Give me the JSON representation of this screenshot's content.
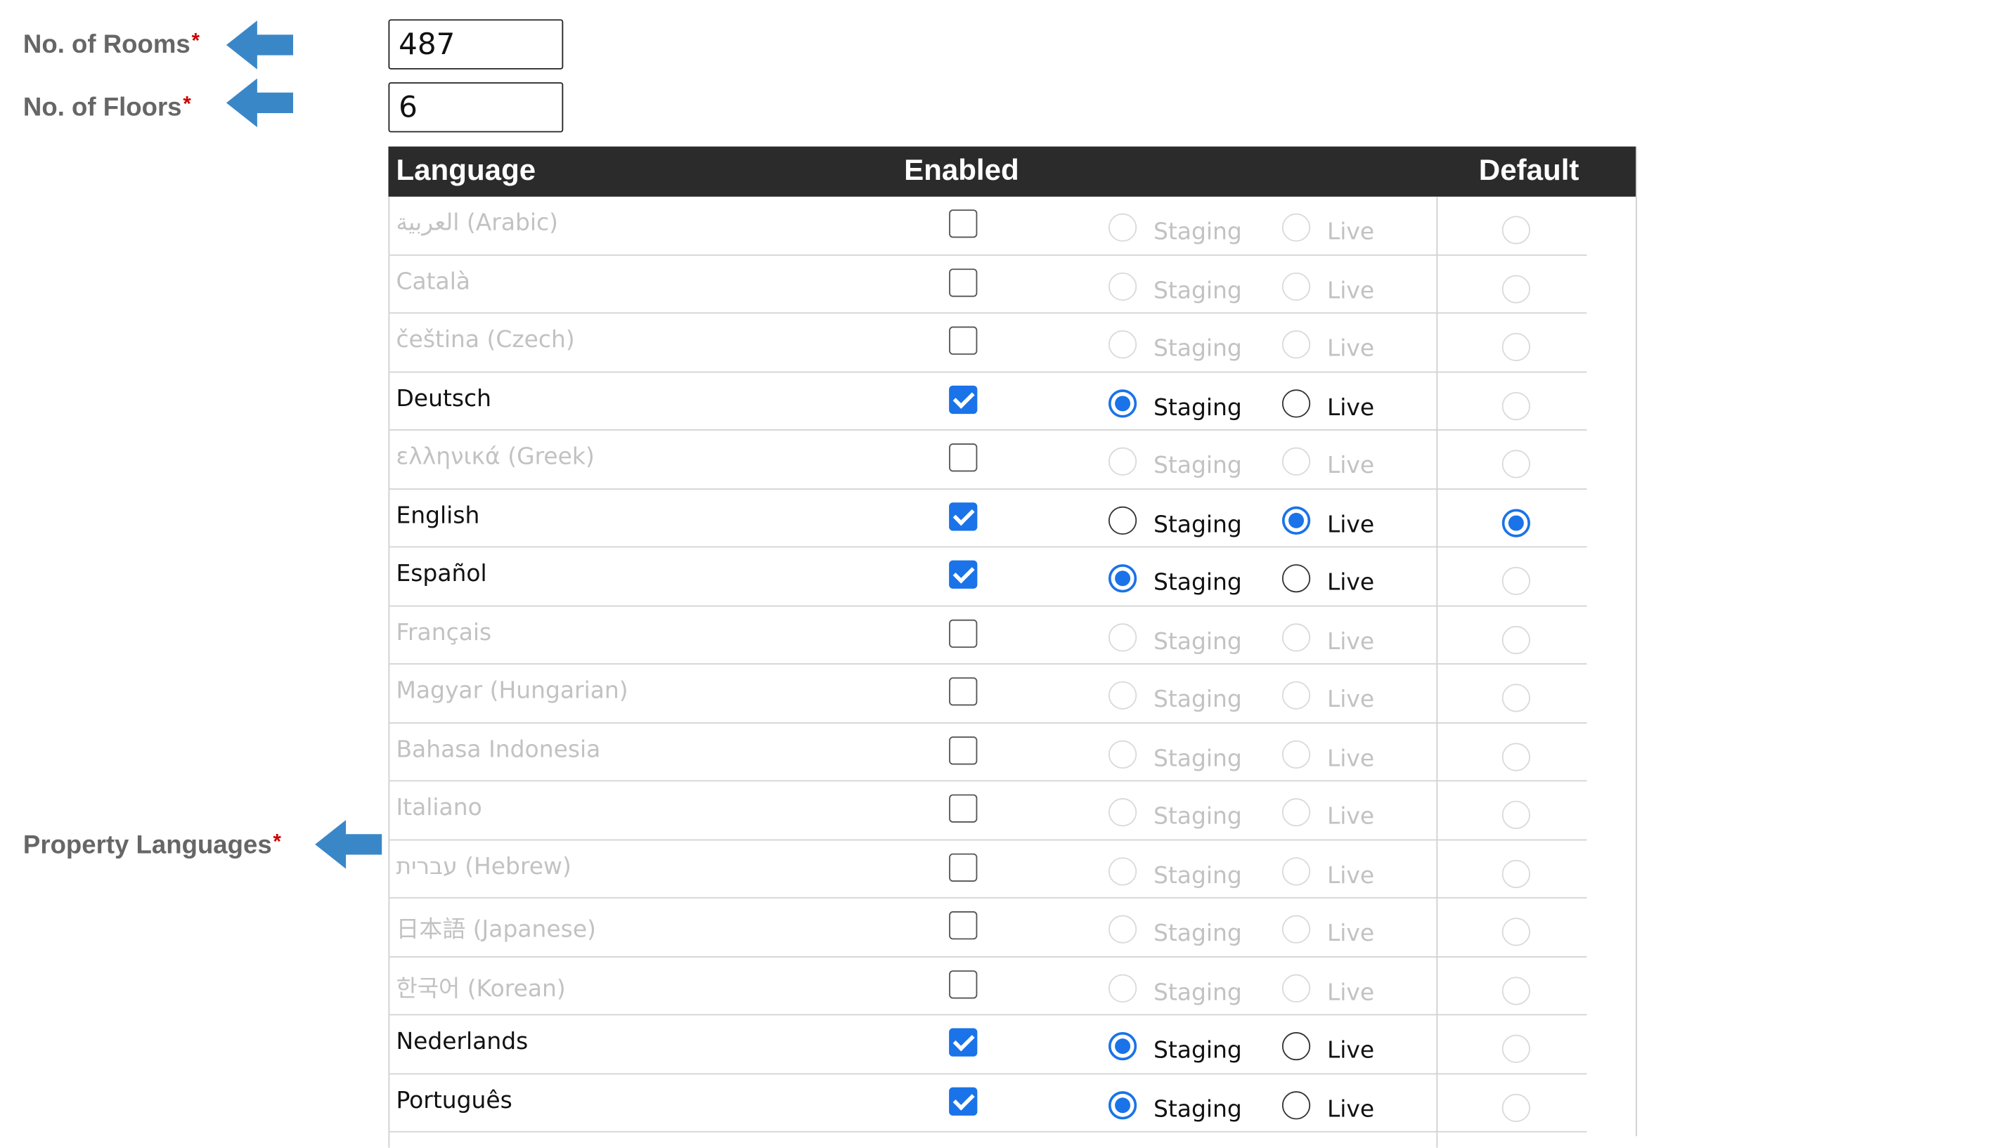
{
  "form": {
    "rooms": {
      "label": "No. of Rooms",
      "required_mark": "*",
      "value": "487"
    },
    "floors": {
      "label": "No. of Floors",
      "required_mark": "*",
      "value": "6"
    },
    "languages": {
      "label": "Property Languages",
      "required_mark": "*"
    }
  },
  "annotations": {
    "arrow_color": "#3a87c8",
    "arrow_icon": "left-arrow-icon"
  },
  "table": {
    "headers": {
      "language": "Language",
      "enabled": "Enabled",
      "default": "Default"
    },
    "option_labels": {
      "staging": "Staging",
      "live": "Live"
    },
    "header_bg": "#2b2b2b",
    "accent": "#1a73e8",
    "rows": [
      {
        "name": "العربية (Arabic)",
        "enabled": false,
        "staging": false,
        "live": false,
        "default": false
      },
      {
        "name": "Català",
        "enabled": false,
        "staging": false,
        "live": false,
        "default": false
      },
      {
        "name": "čeština (Czech)",
        "enabled": false,
        "staging": false,
        "live": false,
        "default": false
      },
      {
        "name": "Deutsch",
        "enabled": true,
        "staging": true,
        "live": false,
        "default": false
      },
      {
        "name": "ελληνικά (Greek)",
        "enabled": false,
        "staging": false,
        "live": false,
        "default": false
      },
      {
        "name": "English",
        "enabled": true,
        "staging": false,
        "live": true,
        "default": true
      },
      {
        "name": "Español",
        "enabled": true,
        "staging": true,
        "live": false,
        "default": false
      },
      {
        "name": "Français",
        "enabled": false,
        "staging": false,
        "live": false,
        "default": false
      },
      {
        "name": "Magyar (Hungarian)",
        "enabled": false,
        "staging": false,
        "live": false,
        "default": false
      },
      {
        "name": "Bahasa Indonesia",
        "enabled": false,
        "staging": false,
        "live": false,
        "default": false
      },
      {
        "name": "Italiano",
        "enabled": false,
        "staging": false,
        "live": false,
        "default": false
      },
      {
        "name": "עברית (Hebrew)",
        "enabled": false,
        "staging": false,
        "live": false,
        "default": false
      },
      {
        "name": "日本語 (Japanese)",
        "enabled": false,
        "staging": false,
        "live": false,
        "default": false
      },
      {
        "name": "한국어 (Korean)",
        "enabled": false,
        "staging": false,
        "live": false,
        "default": false
      },
      {
        "name": "Nederlands",
        "enabled": true,
        "staging": true,
        "live": false,
        "default": false
      },
      {
        "name": "Português",
        "enabled": true,
        "staging": true,
        "live": false,
        "default": false
      }
    ]
  }
}
